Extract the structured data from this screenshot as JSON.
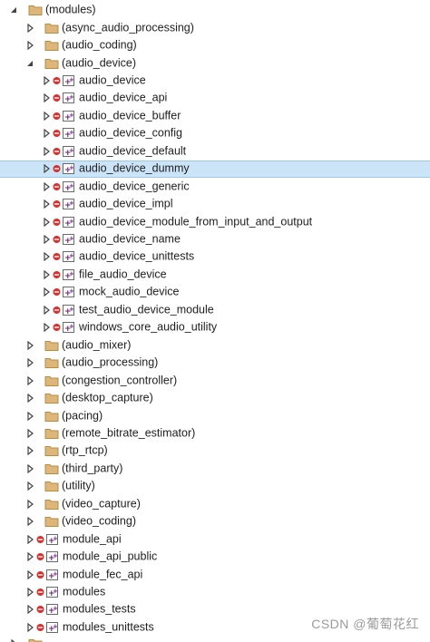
{
  "tree": {
    "root": {
      "label": "(modules)",
      "state": "expanded"
    },
    "items": [
      {
        "label": "(async_audio_processing)",
        "kind": "filter",
        "level": 1,
        "state": "collapsed"
      },
      {
        "label": "(audio_coding)",
        "kind": "filter",
        "level": 1,
        "state": "collapsed"
      },
      {
        "label": "(audio_device)",
        "kind": "filter",
        "level": 1,
        "state": "expanded"
      },
      {
        "label": "audio_device",
        "kind": "project",
        "level": 2,
        "state": "collapsed"
      },
      {
        "label": "audio_device_api",
        "kind": "project",
        "level": 2,
        "state": "collapsed"
      },
      {
        "label": "audio_device_buffer",
        "kind": "project",
        "level": 2,
        "state": "collapsed"
      },
      {
        "label": "audio_device_config",
        "kind": "project",
        "level": 2,
        "state": "collapsed"
      },
      {
        "label": "audio_device_default",
        "kind": "project",
        "level": 2,
        "state": "collapsed"
      },
      {
        "label": "audio_device_dummy",
        "kind": "project",
        "level": 2,
        "state": "collapsed",
        "selected": true
      },
      {
        "label": "audio_device_generic",
        "kind": "project",
        "level": 2,
        "state": "collapsed"
      },
      {
        "label": "audio_device_impl",
        "kind": "project",
        "level": 2,
        "state": "collapsed"
      },
      {
        "label": "audio_device_module_from_input_and_output",
        "kind": "project",
        "level": 2,
        "state": "collapsed"
      },
      {
        "label": "audio_device_name",
        "kind": "project",
        "level": 2,
        "state": "collapsed"
      },
      {
        "label": "audio_device_unittests",
        "kind": "project",
        "level": 2,
        "state": "collapsed"
      },
      {
        "label": "file_audio_device",
        "kind": "project",
        "level": 2,
        "state": "collapsed"
      },
      {
        "label": "mock_audio_device",
        "kind": "project",
        "level": 2,
        "state": "collapsed"
      },
      {
        "label": "test_audio_device_module",
        "kind": "project",
        "level": 2,
        "state": "collapsed"
      },
      {
        "label": "windows_core_audio_utility",
        "kind": "project",
        "level": 2,
        "state": "collapsed"
      },
      {
        "label": "(audio_mixer)",
        "kind": "filter",
        "level": 1,
        "state": "collapsed"
      },
      {
        "label": "(audio_processing)",
        "kind": "filter",
        "level": 1,
        "state": "collapsed"
      },
      {
        "label": "(congestion_controller)",
        "kind": "filter",
        "level": 1,
        "state": "collapsed"
      },
      {
        "label": "(desktop_capture)",
        "kind": "filter",
        "level": 1,
        "state": "collapsed"
      },
      {
        "label": "(pacing)",
        "kind": "filter",
        "level": 1,
        "state": "collapsed"
      },
      {
        "label": "(remote_bitrate_estimator)",
        "kind": "filter",
        "level": 1,
        "state": "collapsed"
      },
      {
        "label": "(rtp_rtcp)",
        "kind": "filter",
        "level": 1,
        "state": "collapsed"
      },
      {
        "label": "(third_party)",
        "kind": "filter",
        "level": 1,
        "state": "collapsed"
      },
      {
        "label": "(utility)",
        "kind": "filter",
        "level": 1,
        "state": "collapsed"
      },
      {
        "label": "(video_capture)",
        "kind": "filter",
        "level": 1,
        "state": "collapsed"
      },
      {
        "label": "(video_coding)",
        "kind": "filter",
        "level": 1,
        "state": "collapsed"
      },
      {
        "label": "module_api",
        "kind": "project",
        "level": 1,
        "state": "collapsed"
      },
      {
        "label": "module_api_public",
        "kind": "project",
        "level": 1,
        "state": "collapsed"
      },
      {
        "label": "module_fec_api",
        "kind": "project",
        "level": 1,
        "state": "collapsed"
      },
      {
        "label": "modules",
        "kind": "project",
        "level": 1,
        "state": "collapsed"
      },
      {
        "label": "modules_tests",
        "kind": "project",
        "level": 1,
        "state": "collapsed"
      },
      {
        "label": "modules_unittests",
        "kind": "project",
        "level": 1,
        "state": "collapsed"
      }
    ]
  },
  "icons": {
    "expanded": "expanded-arrow-icon",
    "collapsed": "collapsed-arrow-icon",
    "filter": "folder-icon",
    "project": "project-icon",
    "status": "excluded-status-icon"
  },
  "colors": {
    "selection_bg": "#cce4f7",
    "selection_border": "#99c9ef",
    "folder": "#dcb67a",
    "project_purple": "#68217a",
    "status_red": "#d9302d"
  },
  "watermark": "CSDN @葡萄花红"
}
